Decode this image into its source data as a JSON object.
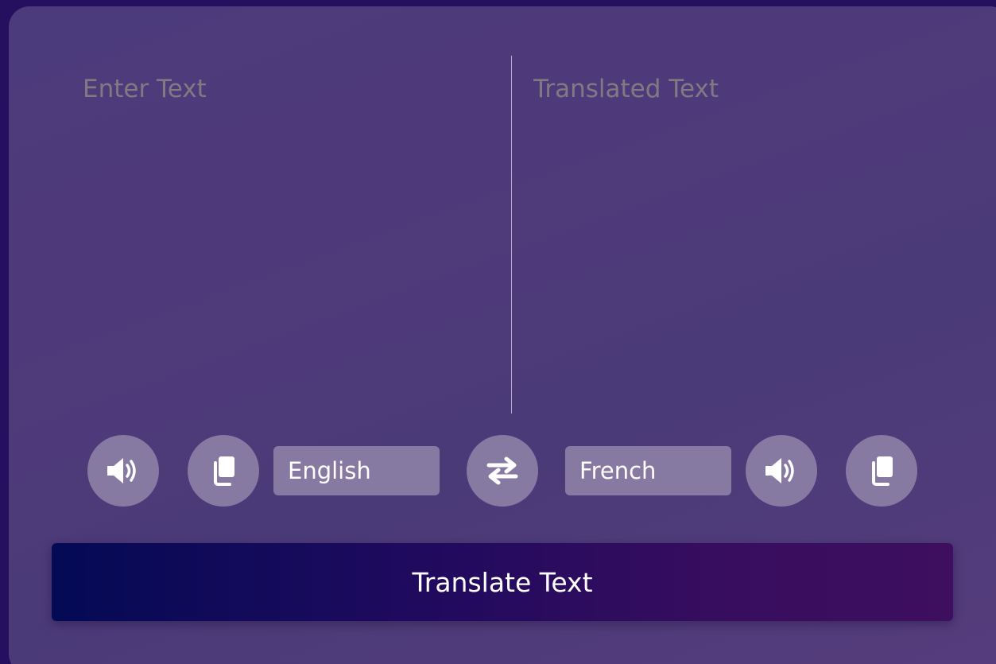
{
  "source": {
    "placeholder": "Enter Text",
    "value": "",
    "language": "English"
  },
  "target": {
    "placeholder": "Translated Text",
    "value": "",
    "language": "French"
  },
  "controls": {
    "speak_icon": "volume-up-icon",
    "copy_icon": "copy-icon",
    "swap_icon": "exchange-arrows-icon"
  },
  "action": {
    "translate_label": "Translate Text"
  },
  "colors": {
    "background": "#24105e",
    "card": "#4f3a7a",
    "control": "#867aa3",
    "button_start": "#040a55",
    "button_end": "#3e0e5f",
    "placeholder": "#807a82"
  }
}
